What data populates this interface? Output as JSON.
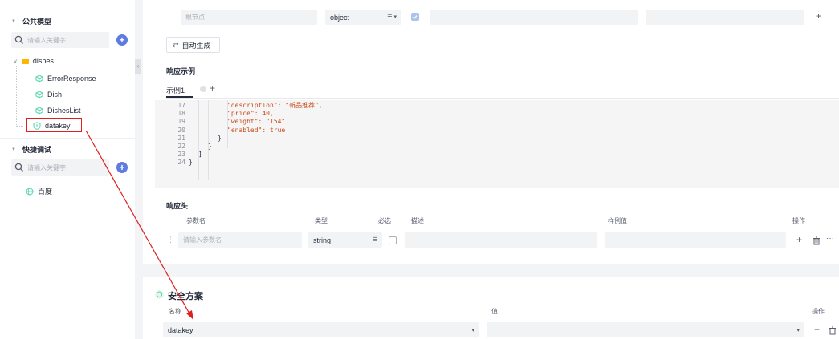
{
  "sidebar": {
    "public_models": {
      "title": "公共模型",
      "search_placeholder": "请输入关键字",
      "folder": "dishes",
      "items": [
        "ErrorResponse",
        "Dish",
        "DishesList",
        "datakey"
      ]
    },
    "quick_debug": {
      "title": "快捷调试",
      "search_placeholder": "请输入关键字",
      "items": [
        "百度"
      ]
    }
  },
  "root_row": {
    "name_placeholder": "根节点",
    "type_value": "object",
    "required_checked": true
  },
  "auto_generate_label": "自动生成",
  "response_example": {
    "title": "响应示例",
    "tab_label": "示例1",
    "code_lines": [
      {
        "n": "17",
        "indent": 4,
        "text": "\"description\": \"新品推荐\","
      },
      {
        "n": "18",
        "indent": 4,
        "text": "\"price\": 40,"
      },
      {
        "n": "19",
        "indent": 4,
        "text": "\"weight\": \"154\","
      },
      {
        "n": "20",
        "indent": 4,
        "text": "\"enabled\": true"
      },
      {
        "n": "21",
        "indent": 3,
        "text": "}"
      },
      {
        "n": "22",
        "indent": 2,
        "text": "}"
      },
      {
        "n": "23",
        "indent": 1,
        "text": "]"
      },
      {
        "n": "24",
        "indent": 0,
        "text": "}"
      }
    ]
  },
  "response_headers": {
    "title": "响应头",
    "columns": {
      "name": "参数名",
      "type": "类型",
      "required": "必选",
      "desc": "描述",
      "example": "样例值",
      "actions": "操作"
    },
    "row": {
      "name_placeholder": "请输入参数名",
      "type_value": "string"
    }
  },
  "security": {
    "title": "安全方案",
    "columns": {
      "name": "名称",
      "value": "值",
      "actions": "操作"
    },
    "row": {
      "name_value": "datakey",
      "value_value": ""
    }
  },
  "colors": {
    "accent": "#5e7ce0",
    "annotation": "#e02020",
    "folder": "#ffb400",
    "model_icon": "#50d4ab"
  }
}
